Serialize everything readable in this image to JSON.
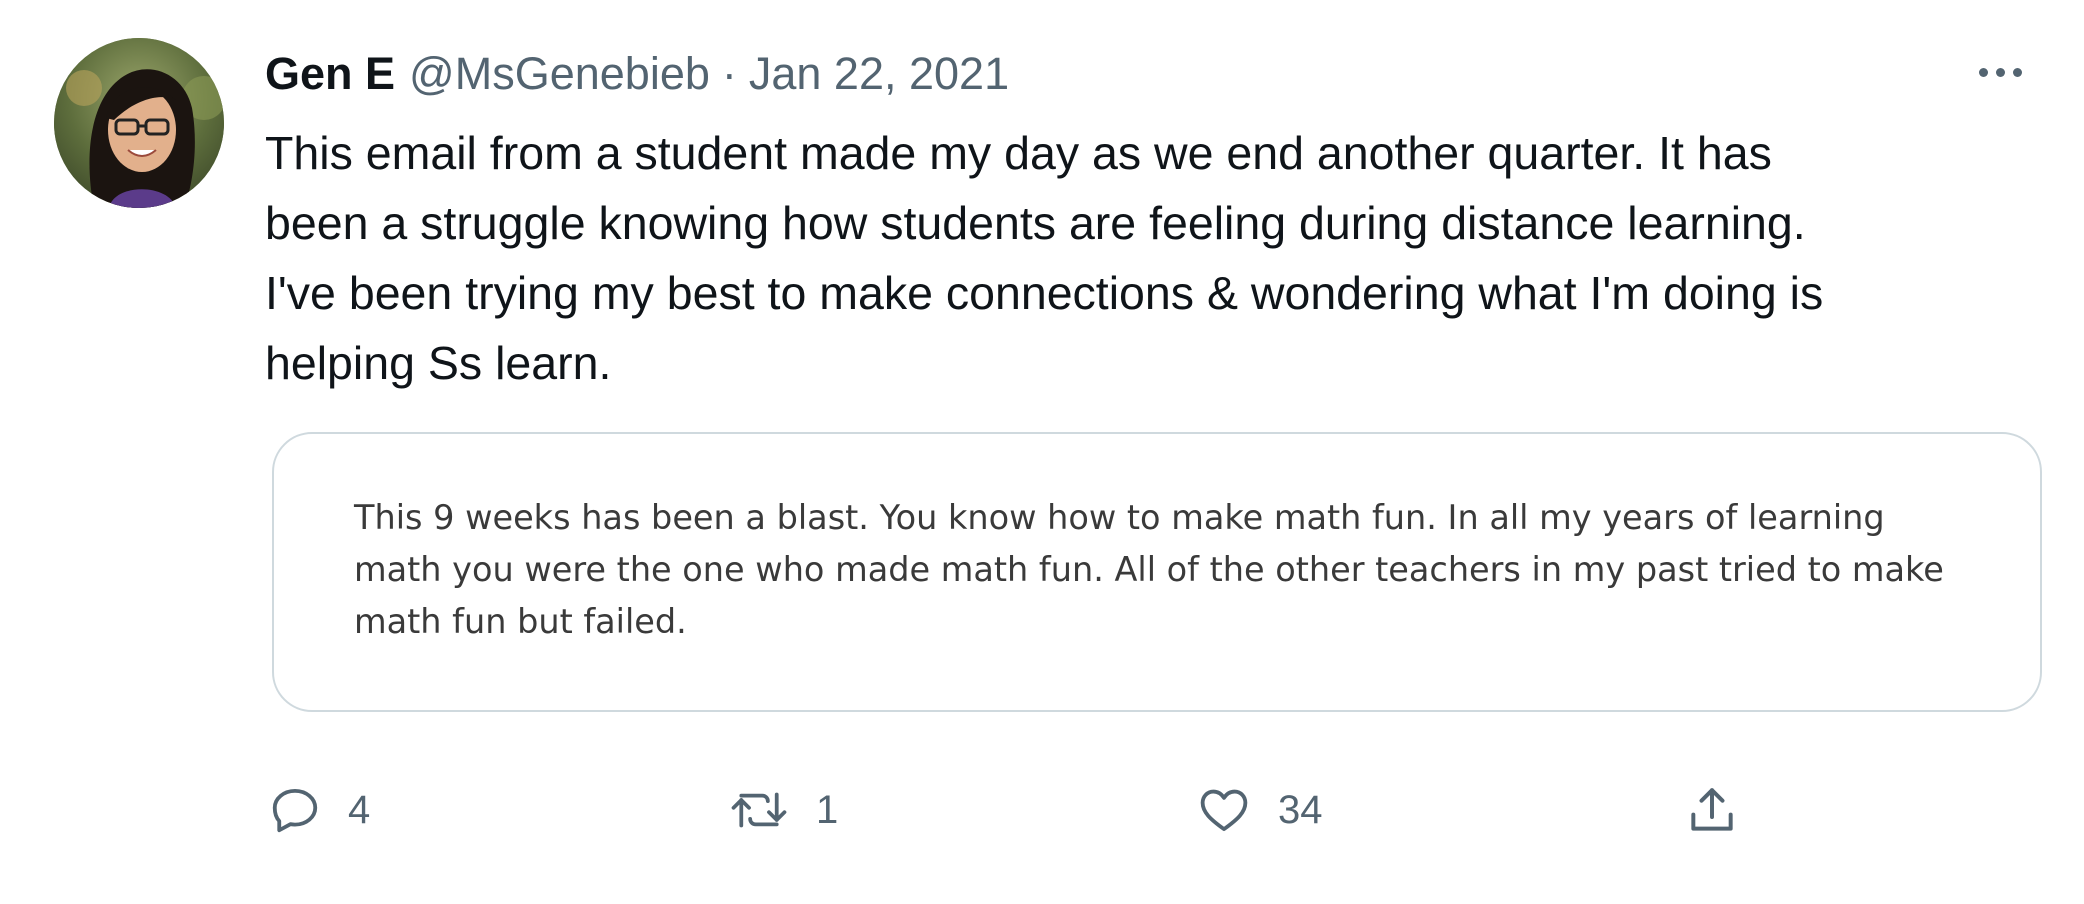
{
  "tweet": {
    "display_name": "Gen E",
    "handle": "@MsGenebieb",
    "separator": "·",
    "date": "Jan 22, 2021",
    "text_lines": [
      "This email from a student made my day as we end another quarter. It has",
      "been a struggle knowing how students are feeling during distance learning.",
      "I've been trying my best to make connections & wondering what I'm doing is",
      "helping Ss learn."
    ],
    "quoted_image_text_lines": [
      "This 9 weeks has been a blast. You know how to make math fun. In all my years of learning",
      "math you were the one who made math fun. All of the other teachers in my past tried to make",
      "math fun but failed."
    ]
  },
  "actions": {
    "reply": {
      "icon": "reply-icon",
      "count": "4"
    },
    "retweet": {
      "icon": "retweet-icon",
      "count": "1"
    },
    "like": {
      "icon": "heart-icon",
      "count": "34"
    },
    "share": {
      "icon": "share-icon"
    }
  },
  "colors": {
    "text_primary": "#0f1419",
    "text_secondary": "#536471",
    "card_border": "#cfd9de",
    "quote_text": "#3a3a3a"
  }
}
